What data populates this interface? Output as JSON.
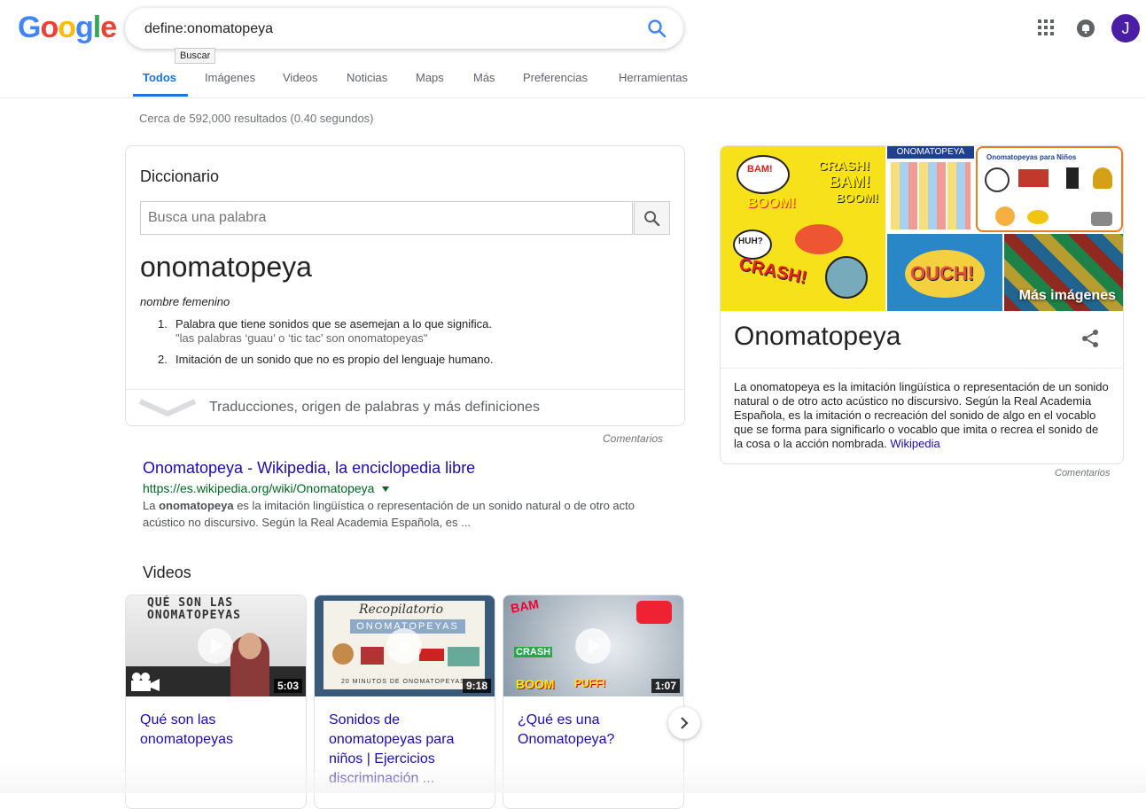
{
  "header": {
    "logo": [
      "G",
      "o",
      "o",
      "g",
      "l",
      "e"
    ],
    "logo_colors": [
      "#4285F4",
      "#EA4335",
      "#FBBC05",
      "#4285F4",
      "#34A853",
      "#EA4335"
    ],
    "query": "define:onomatopeya",
    "search_tooltip": "Buscar",
    "avatar_letter": "J",
    "avatar_color": "#4b1ea6"
  },
  "tabs": [
    "Todos",
    "Imágenes",
    "Videos",
    "Noticias",
    "Maps",
    "Más",
    "Preferencias",
    "Herramientas"
  ],
  "result_stats": "Cerca de 592,000 resultados (0.40 segundos)",
  "dictionary": {
    "title": "Diccionario",
    "search_placeholder": "Busca una palabra",
    "word": "onomatopeya",
    "part_of_speech": "nombre femenino",
    "definitions": [
      {
        "num": "1.",
        "text": "Palabra que tiene sonidos que se asemejan a lo que significa.",
        "example": "\"las palabras ‘guau’ o ‘tic tac’ son onomatopeyas\""
      },
      {
        "num": "2.",
        "text": "Imitación de un sonido que no es propio del lenguaje humano.",
        "example": ""
      }
    ],
    "more_link": "Traducciones, origen de palabras y más definiciones",
    "feedback": "Comentarios"
  },
  "wiki_result": {
    "title": "Onomatopeya - Wikipedia, la enciclopedia libre",
    "url": "https://es.wikipedia.org/wiki/Onomatopeya",
    "snippet_pre": "La ",
    "snippet_bold": "onomatopeya",
    "snippet_post": " es la imitación lingüística o representación de un sonido natural o de otro acto acústico no discursivo. Según la Real Academia Española, es ..."
  },
  "videos": {
    "heading": "Videos",
    "items": [
      {
        "title": "Qué son las onomatopeyas",
        "duration": "5:03",
        "thumb_text": "QUÉ SON LAS ONOMATOPEYAS"
      },
      {
        "title": "Sonidos de onomatopeyas para niños | Ejercicios discriminación ...",
        "duration": "9:18",
        "thumb_text": "Recopilatorio",
        "thumb_text2": "ONOMATOPEYAS",
        "thumb_text3": "20 MINUTOS DE ONOMATOPEYAS"
      },
      {
        "title": "¿Qué es una Onomatopeya?",
        "duration": "1:07",
        "thumb_text": "BAM",
        "thumb_text2": "CRASH",
        "thumb_text3": "BOOM",
        "thumb_text4": "PUFF!"
      }
    ]
  },
  "knowledge_panel": {
    "title": "Onomatopeya",
    "images": {
      "comic_words": [
        "BAM!",
        "CRASH!",
        "BAM!",
        "BOOM!",
        "BOOM!",
        "HUH?",
        "CRASH!"
      ],
      "tile2_title": "ONOMATOPEYA",
      "tile3_title": "Onomatopeyas para Niños",
      "ouch": "OUCH!",
      "more_images": "Más imágenes"
    },
    "description": "La onomatopeya es la imitación lingüística o representación de un sonido natural o de otro acto acústico no discursivo. Según la Real Academia Española, es la imitación o recreación del sonido de algo en el vocablo que se forma para significarlo o vocablo que imita o recrea el sonido de la cosa o la acción nombrada.",
    "source": "Wikipedia",
    "feedback": "Comentarios"
  }
}
